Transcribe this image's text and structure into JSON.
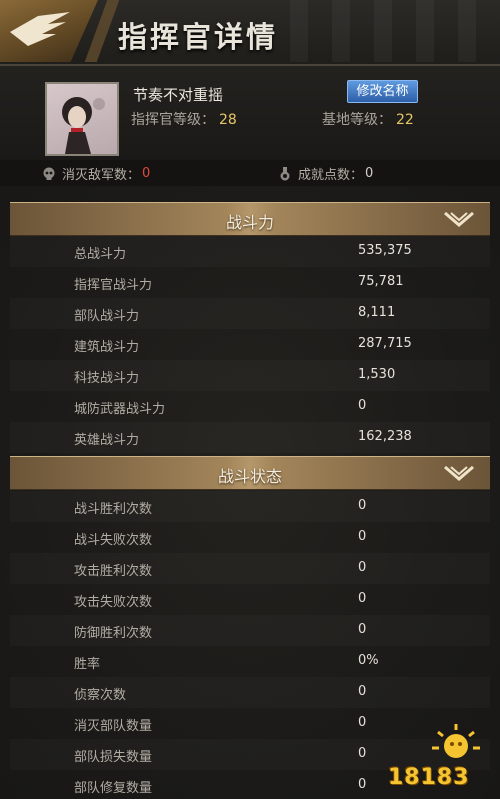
{
  "header": {
    "title": "指挥官详情",
    "back_icon": "eagle-wing-icon"
  },
  "profile": {
    "name": "节奏不对重摇",
    "rename_label": "修改名称",
    "commander_level_label": "指挥官等级：",
    "commander_level": "28",
    "base_level_label": "基地等级：",
    "base_level": "22"
  },
  "stats": {
    "kills_label": "消灭敌军数：",
    "kills": "0",
    "achievement_label": "成就点数：",
    "achievement": "0"
  },
  "sections": [
    {
      "title": "战斗力",
      "rows": [
        {
          "label": "总战斗力",
          "value": "535,375"
        },
        {
          "label": "指挥官战斗力",
          "value": "75,781"
        },
        {
          "label": "部队战斗力",
          "value": "8,111"
        },
        {
          "label": "建筑战斗力",
          "value": "287,715"
        },
        {
          "label": "科技战斗力",
          "value": "1,530"
        },
        {
          "label": "城防武器战斗力",
          "value": "0"
        },
        {
          "label": "英雄战斗力",
          "value": "162,238"
        }
      ]
    },
    {
      "title": "战斗状态",
      "rows": [
        {
          "label": "战斗胜利次数",
          "value": "0"
        },
        {
          "label": "战斗失败次数",
          "value": "0"
        },
        {
          "label": "攻击胜利次数",
          "value": "0"
        },
        {
          "label": "攻击失败次数",
          "value": "0"
        },
        {
          "label": "防御胜利次数",
          "value": "0"
        },
        {
          "label": "胜率",
          "value": "0%"
        },
        {
          "label": "侦察次数",
          "value": "0"
        },
        {
          "label": "消灭部队数量",
          "value": "0"
        },
        {
          "label": "部队损失数量",
          "value": "0"
        },
        {
          "label": "部队修复数量",
          "value": "0"
        }
      ]
    }
  ],
  "watermark": {
    "text": "18183"
  },
  "colors": {
    "accent_gold": "#e6c767",
    "kill_red": "#e04a3c",
    "button_blue": "#3d72c0"
  }
}
